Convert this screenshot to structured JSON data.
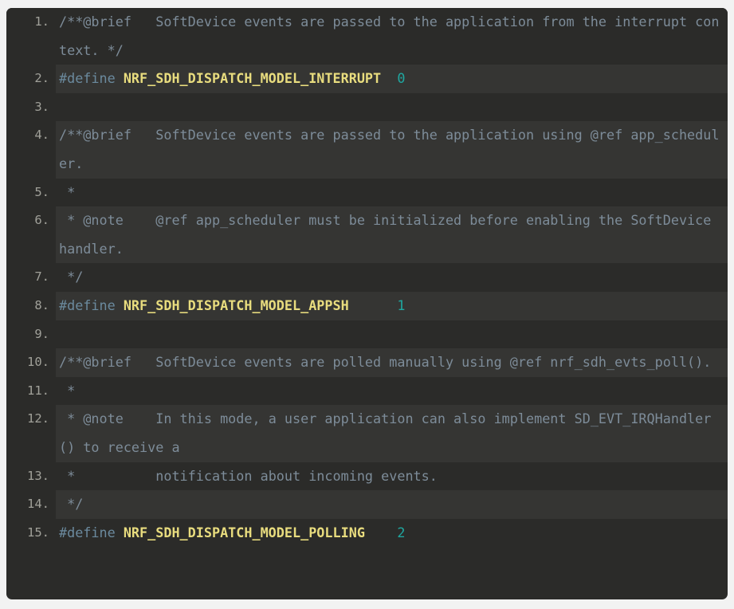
{
  "editor": {
    "language": "c",
    "theme": "dark",
    "colors": {
      "page_background": "#f2f2f2",
      "block_background": "#2b2b29",
      "stripe_background": "#353533",
      "gutter_background": "#2b2b29",
      "line_number": "#a0a099",
      "comment": "#7d8c99",
      "preprocessor": "#6b8a9e",
      "macro_name": "#e8dc7e",
      "number": "#1fa7a0"
    },
    "line_numbers": [
      "1.",
      "2.",
      "3.",
      "4.",
      "5.",
      "6.",
      "7.",
      "8.",
      "9.",
      "10.",
      "11.",
      "12.",
      "13.",
      "14.",
      "15."
    ],
    "lines": [
      {
        "number": "1.",
        "text": "/**@brief   SoftDevice events are passed to the application from the interrupt context. */",
        "tokens": [
          {
            "kind": "comment",
            "text": "/**@brief   SoftDevice events are passed to the application from the interrupt context. */"
          }
        ]
      },
      {
        "number": "2.",
        "text": "#define NRF_SDH_DISPATCH_MODEL_INTERRUPT  0",
        "tokens": [
          {
            "kind": "pre",
            "text": "#define "
          },
          {
            "kind": "macro",
            "text": "NRF_SDH_DISPATCH_MODEL_INTERRUPT"
          },
          {
            "kind": "plain",
            "text": "  "
          },
          {
            "kind": "num",
            "text": "0"
          }
        ]
      },
      {
        "number": "3.",
        "text": "",
        "tokens": []
      },
      {
        "number": "4.",
        "text": "/**@brief   SoftDevice events are passed to the application using @ref app_scheduler.",
        "tokens": [
          {
            "kind": "comment",
            "text": "/**@brief   SoftDevice events are passed to the application using @ref app_scheduler."
          }
        ]
      },
      {
        "number": "5.",
        "text": " *",
        "tokens": [
          {
            "kind": "comment",
            "text": " *"
          }
        ]
      },
      {
        "number": "6.",
        "text": " * @note    @ref app_scheduler must be initialized before enabling the SoftDevice handler.",
        "tokens": [
          {
            "kind": "comment",
            "text": " * @note    @ref app_scheduler must be initialized before enabling the SoftDevice handler."
          }
        ]
      },
      {
        "number": "7.",
        "text": " */",
        "tokens": [
          {
            "kind": "comment",
            "text": " */"
          }
        ]
      },
      {
        "number": "8.",
        "text": "#define NRF_SDH_DISPATCH_MODEL_APPSH      1",
        "tokens": [
          {
            "kind": "pre",
            "text": "#define "
          },
          {
            "kind": "macro",
            "text": "NRF_SDH_DISPATCH_MODEL_APPSH"
          },
          {
            "kind": "plain",
            "text": "      "
          },
          {
            "kind": "num",
            "text": "1"
          }
        ]
      },
      {
        "number": "9.",
        "text": "",
        "tokens": []
      },
      {
        "number": "10.",
        "text": "/**@brief   SoftDevice events are polled manually using @ref nrf_sdh_evts_poll().",
        "tokens": [
          {
            "kind": "comment",
            "text": "/**@brief   SoftDevice events are polled manually using @ref nrf_sdh_evts_poll()."
          }
        ]
      },
      {
        "number": "11.",
        "text": " *",
        "tokens": [
          {
            "kind": "comment",
            "text": " *"
          }
        ]
      },
      {
        "number": "12.",
        "text": " * @note    In this mode, a user application can also implement SD_EVT_IRQHandler() to receive a",
        "tokens": [
          {
            "kind": "comment",
            "text": " * @note    In this mode, a user application can also implement SD_EVT_IRQHandler() to receive a"
          }
        ]
      },
      {
        "number": "13.",
        "text": " *          notification about incoming events.",
        "tokens": [
          {
            "kind": "comment",
            "text": " *          notification about incoming events."
          }
        ]
      },
      {
        "number": "14.",
        "text": " */",
        "tokens": [
          {
            "kind": "comment",
            "text": " */"
          }
        ]
      },
      {
        "number": "15.",
        "text": "#define NRF_SDH_DISPATCH_MODEL_POLLING    2",
        "tokens": [
          {
            "kind": "pre",
            "text": "#define "
          },
          {
            "kind": "macro",
            "text": "NRF_SDH_DISPATCH_MODEL_POLLING"
          },
          {
            "kind": "plain",
            "text": "    "
          },
          {
            "kind": "num",
            "text": "2"
          }
        ]
      }
    ]
  }
}
